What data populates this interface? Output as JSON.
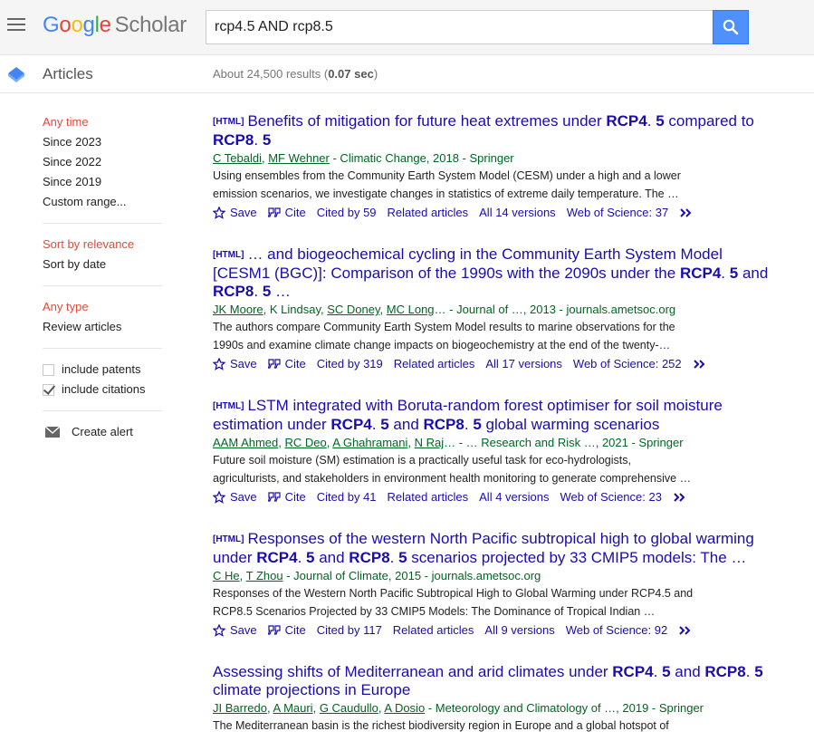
{
  "header": {
    "logo_letters": [
      "G",
      "o",
      "o",
      "g",
      "l",
      "e"
    ],
    "logo_suffix": "Scholar",
    "search_value": "rcp4.5 AND rcp8.5"
  },
  "subbar": {
    "section_label": "Articles",
    "stats_prefix": "About 24,500 results (",
    "stats_time": "0.07 sec",
    "stats_suffix": ")"
  },
  "sidebar": {
    "time": [
      "Any time",
      "Since 2023",
      "Since 2022",
      "Since 2019",
      "Custom range..."
    ],
    "sort": [
      "Sort by relevance",
      "Sort by date"
    ],
    "type": [
      "Any type",
      "Review articles"
    ],
    "include_patents": "include patents",
    "include_citations": "include citations",
    "create_alert": "Create alert"
  },
  "links": {
    "save": "Save",
    "cite": "Cite",
    "related": "Related articles"
  },
  "results": [
    {
      "tag": "[HTML]",
      "title_parts": [
        {
          "t": "Benefits of mitigation for future heat extremes under ",
          "b": false
        },
        {
          "t": "RCP4",
          "b": true
        },
        {
          "t": ". ",
          "b": false
        },
        {
          "t": "5",
          "b": true
        },
        {
          "t": " compared to ",
          "b": false
        },
        {
          "t": "RCP8",
          "b": true
        },
        {
          "t": ". ",
          "b": false
        },
        {
          "t": "5",
          "b": true
        }
      ],
      "authors": [
        "C Tebaldi",
        "MF Wehner"
      ],
      "source": " - Climatic Change, 2018 - Springer",
      "snippet_1": "Using ensembles from the Community Earth System Model (CESM) under a high and a lower",
      "snippet_2": "emission scenarios, we investigate changes in statistics of extreme daily temperature. The …",
      "cited_by": "Cited by 59",
      "versions": "All 14 versions",
      "wos": "Web of Science: 37"
    },
    {
      "tag": "[HTML]",
      "title_parts": [
        {
          "t": "… and biogeochemical cycling in the Community Earth System Model [CESM1 (BGC)]: Comparison of the 1990s with the 2090s under the ",
          "b": false
        },
        {
          "t": "RCP4",
          "b": true
        },
        {
          "t": ". ",
          "b": false
        },
        {
          "t": "5",
          "b": true
        },
        {
          "t": " and ",
          "b": false
        },
        {
          "t": "RCP8",
          "b": true
        },
        {
          "t": ". ",
          "b": false
        },
        {
          "t": "5",
          "b": true
        },
        {
          "t": " …",
          "b": false
        }
      ],
      "authors": [
        "JK Moore",
        "K Lindsay",
        "SC Doney",
        "MC Long"
      ],
      "authors_plain": [
        false,
        true,
        false,
        false
      ],
      "source": "… - Journal of …, 2013 - journals.ametsoc.org",
      "snippet_1": "The authors compare Community Earth System Model results to marine observations for the",
      "snippet_2": "1990s and examine climate change impacts on biogeochemistry at the end of the twenty-…",
      "cited_by": "Cited by 319",
      "versions": "All 17 versions",
      "wos": "Web of Science: 252"
    },
    {
      "tag": "[HTML]",
      "title_parts": [
        {
          "t": "LSTM integrated with Boruta-random forest optimiser for soil moisture estimation under ",
          "b": false
        },
        {
          "t": "RCP4",
          "b": true
        },
        {
          "t": ". ",
          "b": false
        },
        {
          "t": "5",
          "b": true
        },
        {
          "t": " and ",
          "b": false
        },
        {
          "t": "RCP8",
          "b": true
        },
        {
          "t": ". ",
          "b": false
        },
        {
          "t": "5",
          "b": true
        },
        {
          "t": " global warming scenarios",
          "b": false
        }
      ],
      "authors": [
        "AAM Ahmed",
        "RC Deo",
        "A Ghahramani",
        "N Raj"
      ],
      "source": "… - … Research and Risk …, 2021 - Springer",
      "snippet_1": "Future soil moisture (SM) estimation is a practically useful task for eco-hydrologists,",
      "snippet_2": "agriculturists, and stakeholders in environment health monitoring to generate comprehensive …",
      "cited_by": "Cited by 41",
      "versions": "All 4 versions",
      "wos": "Web of Science: 23"
    },
    {
      "tag": "[HTML]",
      "title_parts": [
        {
          "t": "Responses of the western North Pacific subtropical high to global warming under ",
          "b": false
        },
        {
          "t": "RCP4",
          "b": true
        },
        {
          "t": ". ",
          "b": false
        },
        {
          "t": "5",
          "b": true
        },
        {
          "t": " and ",
          "b": false
        },
        {
          "t": "RCP8",
          "b": true
        },
        {
          "t": ". ",
          "b": false
        },
        {
          "t": "5",
          "b": true
        },
        {
          "t": " scenarios projected by 33 CMIP5 models: The …",
          "b": false
        }
      ],
      "authors": [
        "C He",
        "T Zhou"
      ],
      "source": " - Journal of Climate, 2015 - journals.ametsoc.org",
      "snippet_1": "Responses of the Western North Pacific Subtropical High to Global Warming under RCP4.5 and",
      "snippet_2": "RCP8.5 Scenarios Projected by 33 CMIP5 Models: The Dominance of Tropical Indian …",
      "cited_by": "Cited by 117",
      "versions": "All 9 versions",
      "wos": "Web of Science: 92"
    },
    {
      "tag": "",
      "title_parts": [
        {
          "t": "Assessing shifts of Mediterranean and arid climates under ",
          "b": false
        },
        {
          "t": "RCP4",
          "b": true
        },
        {
          "t": ". ",
          "b": false
        },
        {
          "t": "5",
          "b": true
        },
        {
          "t": " and ",
          "b": false
        },
        {
          "t": "RCP8",
          "b": true
        },
        {
          "t": ". ",
          "b": false
        },
        {
          "t": "5",
          "b": true
        },
        {
          "t": " climate projections in Europe",
          "b": false
        }
      ],
      "authors": [
        "JI Barredo",
        "A Mauri",
        "G Caudullo",
        "A Dosio"
      ],
      "source": " - Meteorology and Climatology of …, 2019 - Springer",
      "snippet_1": "The Mediterranean basin is the richest biodiversity region in Europe and a global hotspot of",
      "snippet_2": "",
      "cited_by": "",
      "versions": "",
      "wos": ""
    }
  ],
  "colors": {
    "link": "#1a0dab",
    "author_green": "#006621",
    "active_red": "#dd4b39",
    "search_blue": "#4d90fe"
  }
}
